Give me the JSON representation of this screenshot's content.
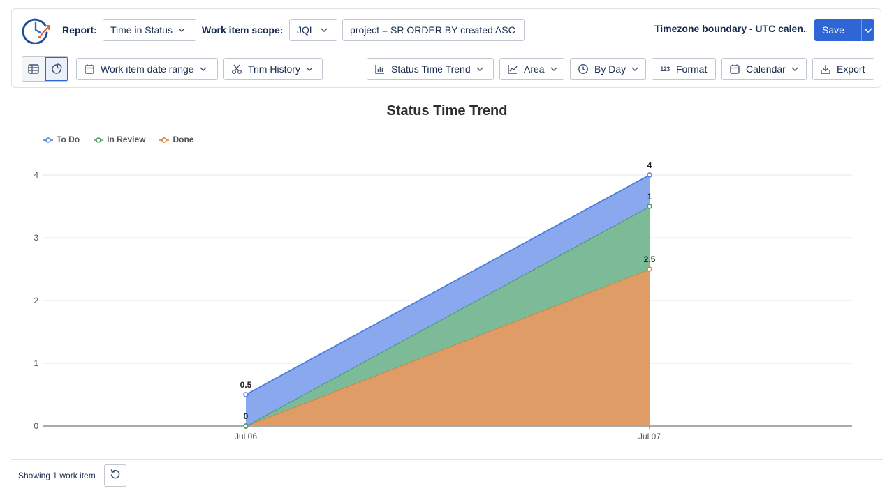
{
  "header": {
    "report_label": "Report:",
    "report_value": "Time in Status",
    "scope_label": "Work item scope:",
    "scope_mode": "JQL",
    "jql_query": "project = SR ORDER BY created ASC",
    "timezone_text": "Timezone boundary - UTC calen...",
    "save_label": "Save"
  },
  "toolbar": {
    "date_range_label": "Work item date range",
    "trim_history_label": "Trim History",
    "chart_kind_label": "Status Time Trend",
    "chart_style_label": "Area",
    "grouping_label": "By Day",
    "format_label": "Format",
    "calendar_label": "Calendar",
    "export_label": "Export"
  },
  "colors": {
    "accent": "#2f66d6",
    "todo": "#4a7de0",
    "in_review": "#3d9a5c",
    "done": "#e07a30"
  },
  "chart_data": {
    "type": "area",
    "title": "Status Time Trend",
    "stacked": true,
    "x": [
      "Jul 06",
      "Jul 07"
    ],
    "yticks": [
      0,
      1,
      2,
      3,
      4
    ],
    "ylim": [
      0,
      4
    ],
    "legend_position": "top-left",
    "series": [
      {
        "name": "To Do",
        "values": [
          0.5,
          0.5
        ],
        "top_labels": [
          "0.5",
          "4"
        ]
      },
      {
        "name": "In Review",
        "values": [
          0,
          1
        ],
        "top_labels": [
          "0",
          "1"
        ]
      },
      {
        "name": "Done",
        "values": [
          0,
          2.5
        ],
        "top_labels": [
          "",
          "2.5"
        ]
      }
    ],
    "grid": true
  },
  "footer": {
    "showing_text": "Showing 1 work item"
  }
}
